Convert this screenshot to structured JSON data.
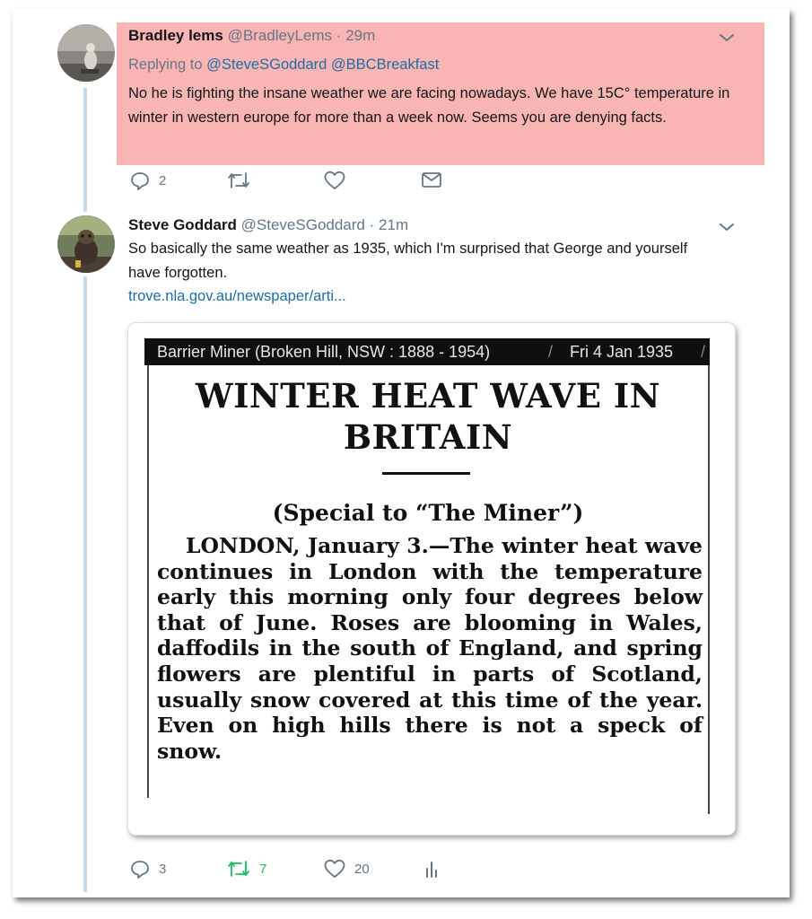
{
  "tweets": [
    {
      "name": "Bradley lems",
      "handle": "@BradleyLems",
      "separator": "·",
      "time": "29m",
      "replying_label": "Replying to",
      "mention1": "@SteveSGoddard",
      "mention2": "@BBCBreakfast",
      "text": "No he is fighting the insane weather we are facing nowadays. We have 15C° temperature in winter in western europe for more than a week now. Seems you are denying facts.",
      "reply_count": "2",
      "retweet_count": "",
      "like_count": "",
      "highlight_color": "#f9b4b4"
    },
    {
      "name": "Steve Goddard",
      "handle": "@SteveSGoddard",
      "separator": "·",
      "time": "21m",
      "text": "So basically the same weather as 1935, which I'm surprised that George and yourself have forgotten.",
      "link": "trove.nla.gov.au/newspaper/arti...",
      "reply_count": "3",
      "retweet_count": "7",
      "like_count": "20",
      "retweet_color": "#17bf63"
    }
  ],
  "card": {
    "source": "Barrier Miner (Broken Hill, NSW : 1888 - 1954)",
    "slash": "/",
    "date": "Fri 4 Jan 1935",
    "headline_line1": "WINTER HEAT WAVE IN",
    "headline_line2": "BRITAIN",
    "special": "(Special to “The Miner”)",
    "paragraph": "LONDON, January 3.—The winter heat wave continues in London with the temperature early this morning only four degrees below that of June. Roses are blooming in Wales, daffodils in the south of England, and spring flowers are plentiful in parts of Scotland, usually snow covered at this time of the year. Even on high hills there is not a speck of snow."
  },
  "icons": [
    "reply-icon",
    "retweet-icon",
    "like-icon",
    "dm-icon",
    "analytics-icon",
    "chevron-down-icon"
  ],
  "colors": {
    "accent": "#1b6fa6",
    "muted": "#657786",
    "thread_line": "#c4d9ea"
  }
}
